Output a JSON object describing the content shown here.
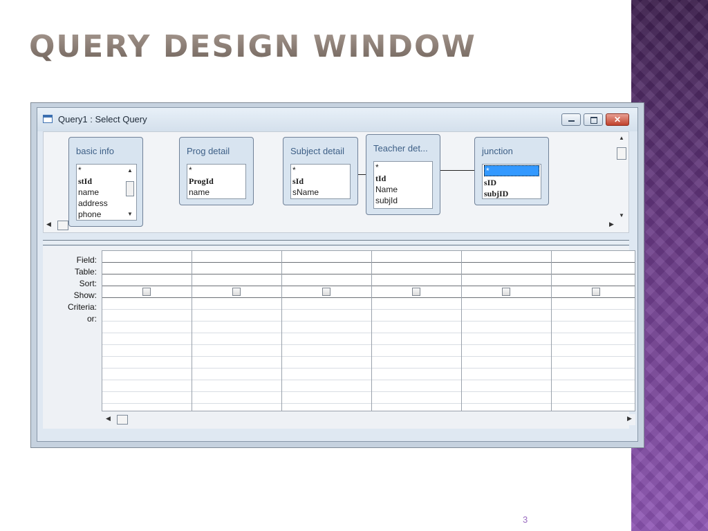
{
  "slide": {
    "title": "QUERY DESIGN WINDOW",
    "page_number": "3"
  },
  "window": {
    "title": "Query1 : Select Query",
    "controls": {
      "minimize": "minimize",
      "maximize": "maximize",
      "close": "✕"
    }
  },
  "tables": [
    {
      "name": "basic info",
      "fields": [
        {
          "label": "*",
          "key": false
        },
        {
          "label": "stId",
          "key": true
        },
        {
          "label": "name",
          "key": false
        },
        {
          "label": "address",
          "key": false
        },
        {
          "label": "phone",
          "key": false
        }
      ]
    },
    {
      "name": "Prog detail",
      "fields": [
        {
          "label": "*",
          "key": false
        },
        {
          "label": "ProgId",
          "key": true
        },
        {
          "label": "name",
          "key": false
        }
      ]
    },
    {
      "name": "Subject detail",
      "fields": [
        {
          "label": "*",
          "key": false
        },
        {
          "label": "sId",
          "key": true
        },
        {
          "label": "sName",
          "key": false
        }
      ]
    },
    {
      "name": "Teacher det...",
      "fields": [
        {
          "label": "*",
          "key": false
        },
        {
          "label": "tId",
          "key": true
        },
        {
          "label": "Name",
          "key": false
        },
        {
          "label": "subjId",
          "key": false
        }
      ]
    },
    {
      "name": "junction",
      "fields": [
        {
          "label": "*",
          "key": false,
          "selected": true
        },
        {
          "label": "sID",
          "key": true
        },
        {
          "label": "subjID",
          "key": true
        }
      ]
    }
  ],
  "grid": {
    "row_labels": [
      "Field:",
      "Table:",
      "Sort:",
      "Show:",
      "Criteria:",
      "or:"
    ],
    "column_count": 6,
    "show_checked": [
      false,
      false,
      false,
      false,
      false,
      false
    ]
  },
  "colors": {
    "accent_title": "#8a7b72",
    "side_band": "#6a3a86",
    "selection": "#3399ff"
  }
}
